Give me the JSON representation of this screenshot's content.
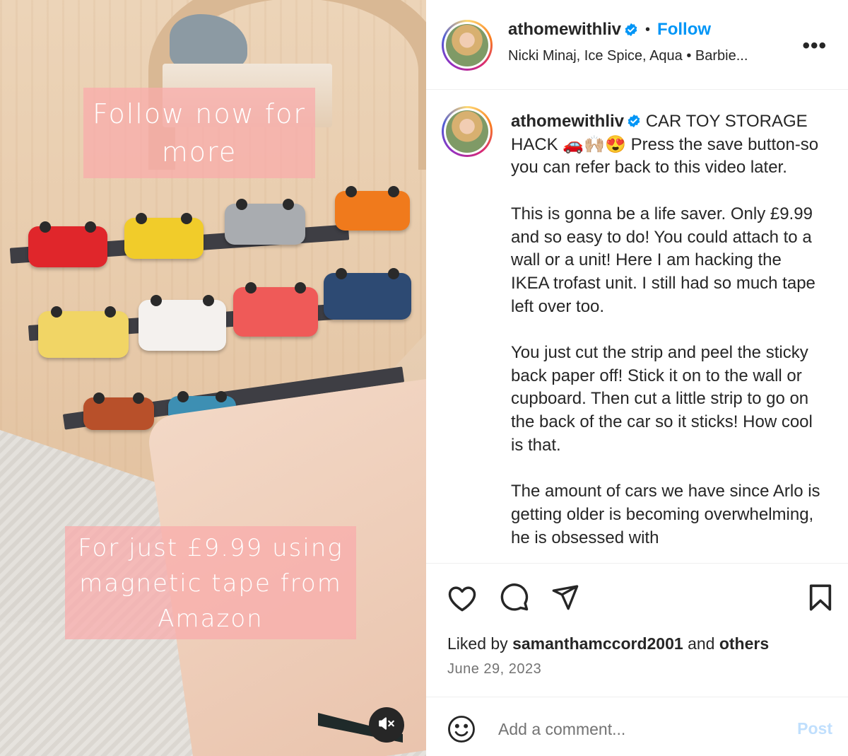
{
  "media": {
    "caption_top": "Follow now for more",
    "caption_bottom": "For just £9.99 using magnetic tape from Amazon",
    "mute_icon": "speaker-muted-icon"
  },
  "header": {
    "username": "athomewithliv",
    "separator": "•",
    "follow_label": "Follow",
    "audio": "Nicki Minaj, Ice Spice, Aqua • Barbie...",
    "more_label": "•••"
  },
  "caption": {
    "username": "athomewithliv",
    "paragraphs": [
      "CAR TOY STORAGE HACK 🚗🙌🏼😍 Press the save button-so you can refer back to this video later.",
      "This is gonna be a life saver. Only £9.99 and so easy to do! You could attach to a wall or a unit! Here I am hacking the IKEA trofast unit. I still had so much tape left over too.",
      "You just cut the strip and peel the sticky back paper off! Stick it on to the wall or cupboard. Then cut a little strip to go on the back of the car so it sticks! How cool is that.",
      "The amount of cars we have since Arlo is getting older is becoming overwhelming, he is obsessed with"
    ]
  },
  "actions": {
    "liked_prefix": "Liked by",
    "liked_user": "samanthamccord2001",
    "liked_and": "and",
    "liked_others": "others",
    "date": "June 29, 2023"
  },
  "comment": {
    "placeholder": "Add a comment...",
    "post_label": "Post"
  },
  "colors": {
    "link_blue": "#0095f6",
    "post_disabled": "#c0dffd",
    "muted_text": "#737373"
  }
}
